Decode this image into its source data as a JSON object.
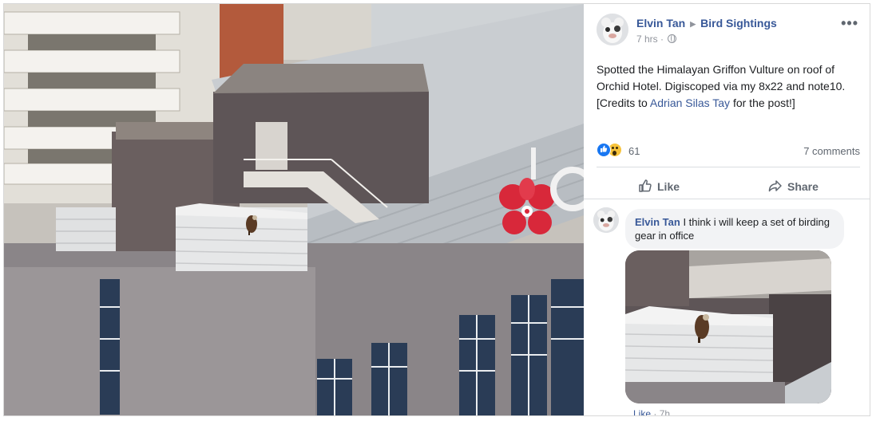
{
  "post": {
    "author": "Elvin Tan",
    "group": "Bird Sightings",
    "time": "7 hrs",
    "separator": "·",
    "more_icon": "more-horizontal-icon",
    "text_before_link": "Spotted the Himalayan Griffon Vulture on roof of Orchid Hotel. Digiscoped via my 8x22 and note10. [Credits to ",
    "link_text": "Adrian Silas Tay",
    "text_after_link": " for the post!]",
    "reaction_count": "61",
    "comments_count": "7 comments",
    "like_label": "Like",
    "share_label": "Share"
  },
  "comment": {
    "author": "Elvin Tan",
    "text": " I think i will keep a set of birding gear in office",
    "like_label": "Like",
    "separator": " · ",
    "time": "7h"
  },
  "colors": {
    "link": "#385898",
    "like_blue": "#1877f2",
    "wow_yellow": "#f7c33b",
    "orchid_red": "#d8283a"
  }
}
